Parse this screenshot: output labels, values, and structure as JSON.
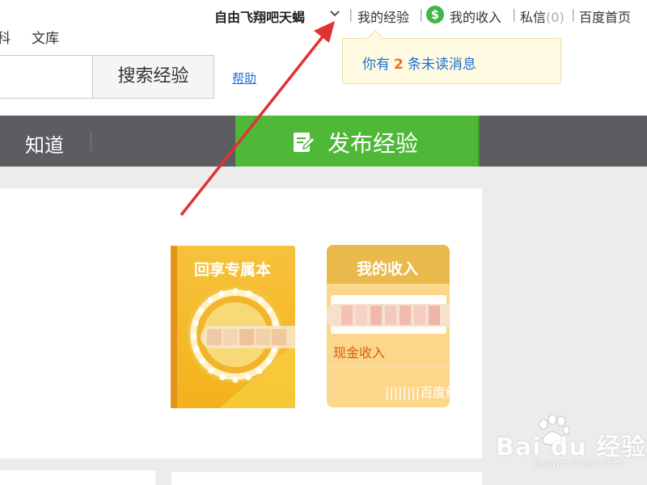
{
  "topbar": {
    "user_name": "自由飞翔吧天蝎",
    "separator": "|",
    "my_experience": "我的经验",
    "dollar_symbol": "$",
    "my_income": "我的收入",
    "messages_label": "私信",
    "messages_count": "(0)",
    "home": "百度首页"
  },
  "nav_fragments": [
    "科",
    "文库"
  ],
  "search": {
    "button_label": "搜索经验",
    "help_link": "帮助"
  },
  "notification": {
    "prefix": "你有",
    "count": "2",
    "suffix": "条未读消息"
  },
  "navbar": {
    "zhidao": "知道",
    "publish_label": "发布经验"
  },
  "cards": {
    "book": {
      "title": "回享专属本"
    },
    "income": {
      "title": "我的收入",
      "cash_label": "现金收入",
      "brand": "||||||||百度经验"
    }
  },
  "watermark": {
    "logo": "Bai du 经验",
    "url": "jingyan.baidu.com"
  },
  "colors": {
    "publish_green": "#4fb838",
    "navbar_gray": "#5c5d60",
    "link_blue": "#1f6fd1",
    "arrow_red": "#e03232",
    "card_orange": "#f4b425"
  }
}
